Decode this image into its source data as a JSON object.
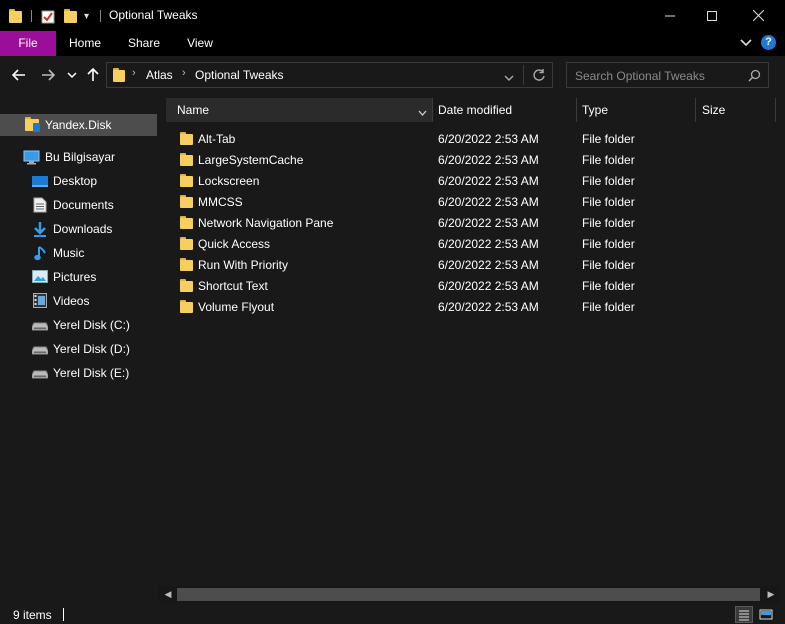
{
  "window": {
    "title": "Optional Tweaks",
    "minimize_icon": "minimize-icon",
    "maximize_icon": "maximize-icon",
    "close_icon": "close-icon"
  },
  "ribbon": {
    "tabs": [
      {
        "label": "File"
      },
      {
        "label": "Home"
      },
      {
        "label": "Share"
      },
      {
        "label": "View"
      }
    ],
    "accent": "#9a0e9a"
  },
  "address": {
    "crumbs": [
      "Atlas",
      "Optional Tweaks"
    ]
  },
  "search": {
    "placeholder": "Search Optional Tweaks"
  },
  "sidebar": {
    "quick": {
      "label": "Yandex.Disk"
    },
    "pc": {
      "label": "Bu Bilgisayar"
    },
    "items": [
      {
        "label": "Desktop",
        "icon": "desktop-icon"
      },
      {
        "label": "Documents",
        "icon": "documents-icon"
      },
      {
        "label": "Downloads",
        "icon": "downloads-icon"
      },
      {
        "label": "Music",
        "icon": "music-icon"
      },
      {
        "label": "Pictures",
        "icon": "pictures-icon"
      },
      {
        "label": "Videos",
        "icon": "videos-icon"
      },
      {
        "label": "Yerel Disk (C:)",
        "icon": "drive-icon"
      },
      {
        "label": "Yerel Disk (D:)",
        "icon": "drive-icon"
      },
      {
        "label": "Yerel Disk (E:)",
        "icon": "drive-icon"
      }
    ]
  },
  "columns": {
    "name": "Name",
    "date": "Date modified",
    "type": "Type",
    "size": "Size"
  },
  "files": [
    {
      "name": "Alt-Tab",
      "date": "6/20/2022 2:53 AM",
      "type": "File folder"
    },
    {
      "name": "LargeSystemCache",
      "date": "6/20/2022 2:53 AM",
      "type": "File folder"
    },
    {
      "name": "Lockscreen",
      "date": "6/20/2022 2:53 AM",
      "type": "File folder"
    },
    {
      "name": "MMCSS",
      "date": "6/20/2022 2:53 AM",
      "type": "File folder"
    },
    {
      "name": "Network Navigation Pane",
      "date": "6/20/2022 2:53 AM",
      "type": "File folder"
    },
    {
      "name": "Quick Access",
      "date": "6/20/2022 2:53 AM",
      "type": "File folder"
    },
    {
      "name": "Run With Priority",
      "date": "6/20/2022 2:53 AM",
      "type": "File folder"
    },
    {
      "name": "Shortcut Text",
      "date": "6/20/2022 2:53 AM",
      "type": "File folder"
    },
    {
      "name": "Volume Flyout",
      "date": "6/20/2022 2:53 AM",
      "type": "File folder"
    }
  ],
  "status": {
    "count": "9 items"
  }
}
